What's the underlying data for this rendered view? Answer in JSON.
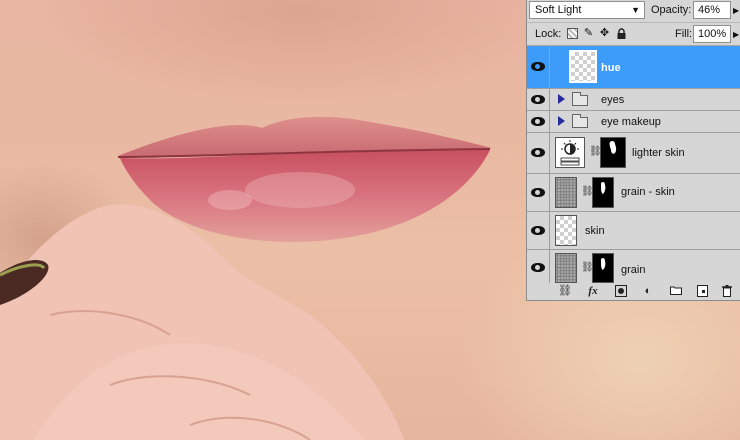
{
  "layers_panel": {
    "blend_mode": "Soft Light",
    "opacity_label": "Opacity:",
    "opacity_value": "46%",
    "lock_label": "Lock:",
    "fill_label": "Fill:",
    "fill_value": "100%",
    "layers": [
      {
        "name": "hue",
        "type": "layer",
        "selected": true,
        "visible": true
      },
      {
        "name": "eyes",
        "type": "group",
        "selected": false,
        "visible": true
      },
      {
        "name": "eye makeup",
        "type": "group",
        "selected": false,
        "visible": true
      },
      {
        "name": "lighter skin",
        "type": "adjustment",
        "selected": false,
        "visible": true
      },
      {
        "name": "grain - skin",
        "type": "layer-with-mask",
        "selected": false,
        "visible": true
      },
      {
        "name": "skin",
        "type": "layer",
        "selected": false,
        "visible": true
      },
      {
        "name": "grain",
        "type": "layer-with-mask",
        "selected": false,
        "visible": true
      }
    ],
    "footer_icons": [
      "link-layers-icon",
      "fx-icon",
      "add-mask-icon",
      "adjustment-layer-icon",
      "new-group-icon",
      "new-layer-icon",
      "trash-icon"
    ],
    "fx_label": "fx",
    "selection_color": "#3d9bfa"
  }
}
